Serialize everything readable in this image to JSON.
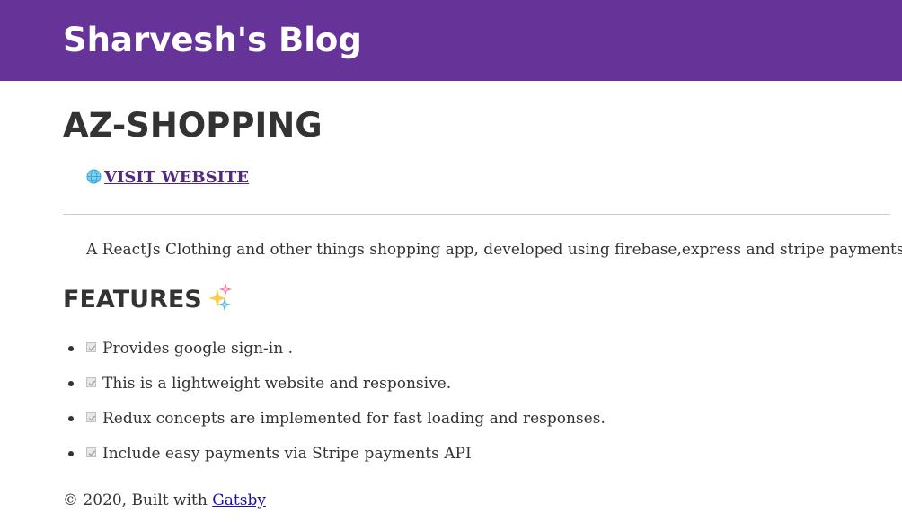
{
  "header": {
    "site_title": "Sharvesh's Blog",
    "background_color": "#663399"
  },
  "post": {
    "title": "AZ-SHOPPING",
    "visit_link": {
      "icon": "globe-icon",
      "label": "VISIT WEBSITE"
    },
    "description": "A ReactJs Clothing and other things shopping app, developed using firebase,express and stripe payments.",
    "features_heading": "FEATURES",
    "features_heading_icon": "sparkles-icon",
    "features": [
      {
        "icon": "checkbox-checked-icon",
        "text": "Provides google sign-in ."
      },
      {
        "icon": "checkbox-checked-icon",
        "text": "This is a lightweight website and responsive."
      },
      {
        "icon": "checkbox-checked-icon",
        "text": "Redux concepts are implemented for fast loading and responses."
      },
      {
        "icon": "checkbox-checked-icon",
        "text": "Include easy payments via Stripe payments API"
      }
    ]
  },
  "footer": {
    "prefix": "© 2020, Built with ",
    "link_label": "Gatsby"
  },
  "colors": {
    "text": "#333333",
    "link_visited": "#55287f",
    "link": "#1a0dab",
    "divider": "#cccccc"
  }
}
